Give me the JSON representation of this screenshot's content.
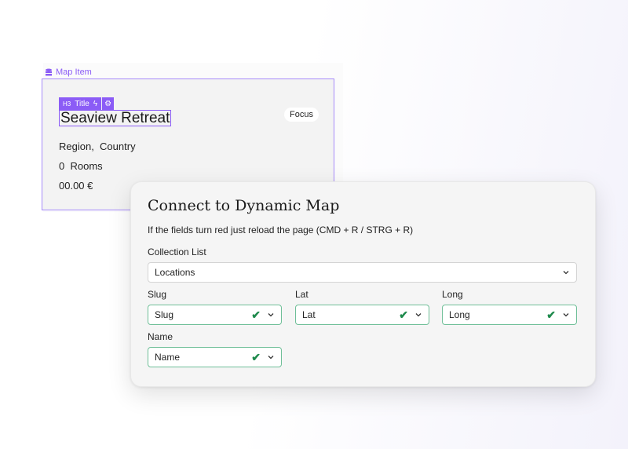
{
  "map_item": {
    "label": "Map Item",
    "tag": "H3",
    "tag_label": "Title",
    "title": "Seaview Retreat",
    "focus": "Focus",
    "region": "Region,",
    "country": "Country",
    "rooms_count": "0",
    "rooms": "Rooms",
    "price": "00.00 €"
  },
  "dialog": {
    "title": "Connect to Dynamic Map",
    "subtitle": "If the fields turn red just reload the page (CMD + R / STRG + R)",
    "collection_label": "Collection List",
    "collection_value": "Locations",
    "fields": [
      {
        "label": "Slug",
        "value": "Slug"
      },
      {
        "label": "Lat",
        "value": "Lat"
      },
      {
        "label": "Long",
        "value": "Long"
      },
      {
        "label": "Name",
        "value": "Name"
      }
    ]
  },
  "colors": {
    "accent": "#8b5cf6",
    "ok": "#1e8a4c"
  }
}
